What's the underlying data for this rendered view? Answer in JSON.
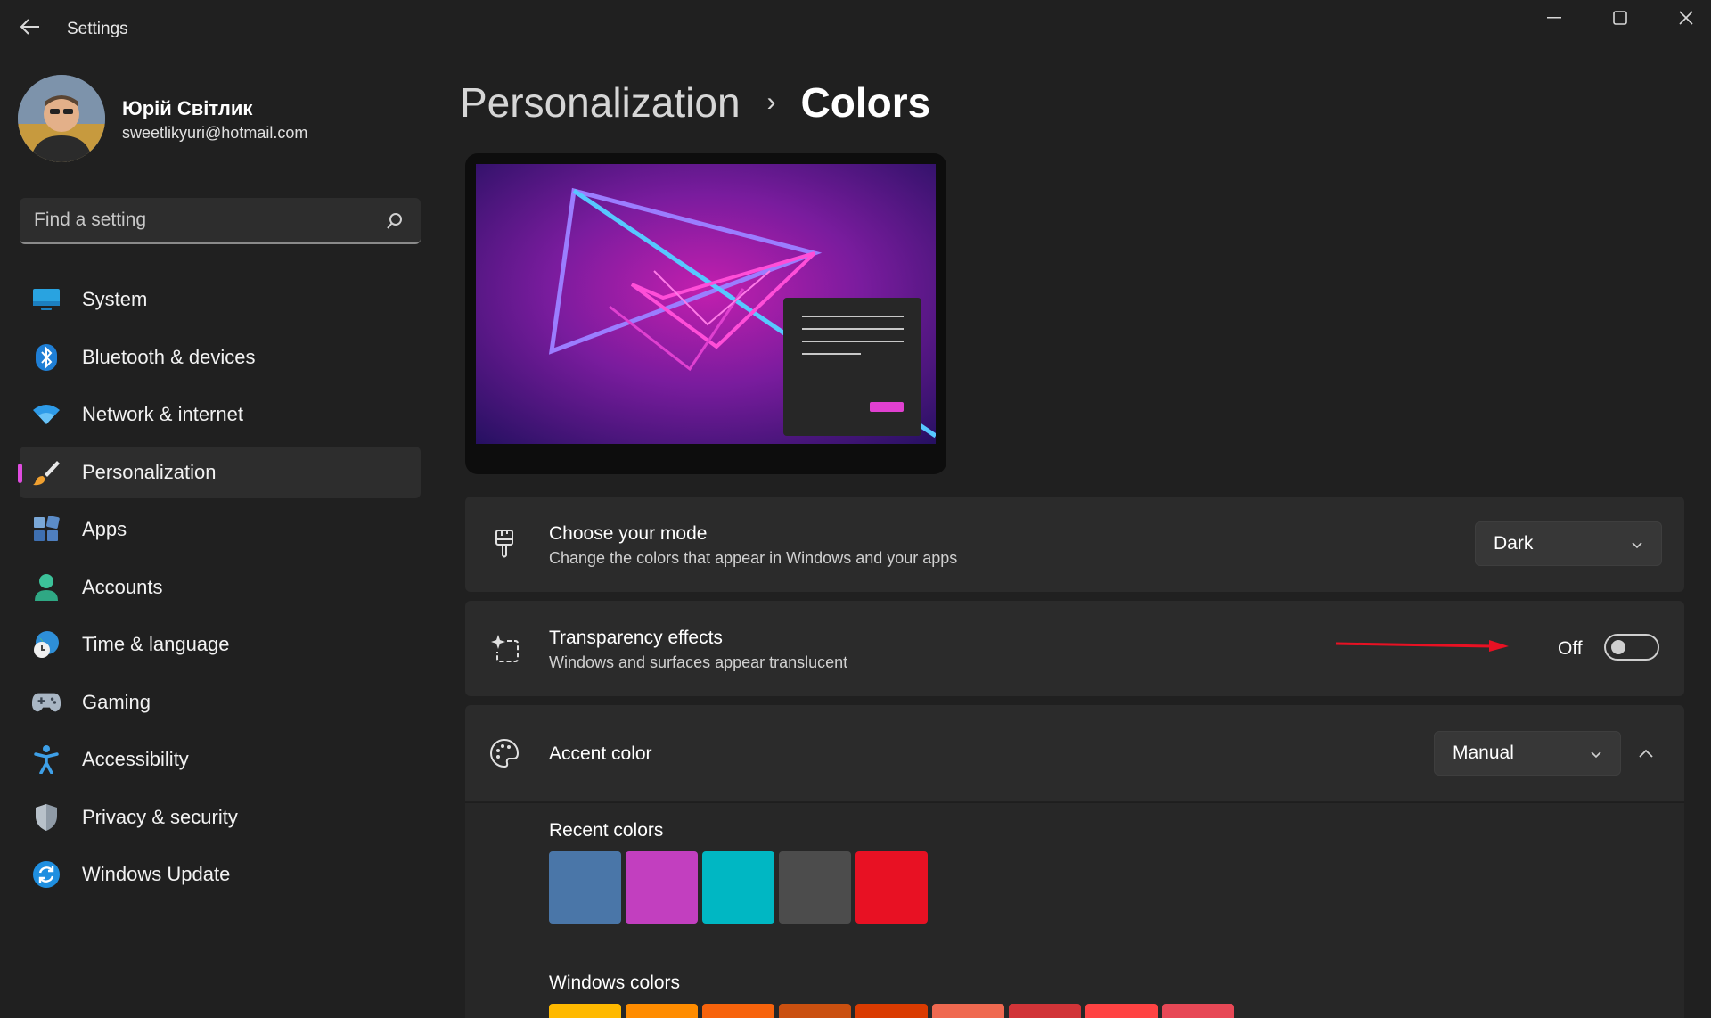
{
  "window": {
    "title": "Settings"
  },
  "profile": {
    "name": "Юрій Світлик",
    "email": "sweetlikyuri@hotmail.com"
  },
  "search": {
    "placeholder": "Find a setting"
  },
  "sidebar": {
    "items": [
      {
        "label": "System",
        "icon": "monitor-icon"
      },
      {
        "label": "Bluetooth & devices",
        "icon": "bluetooth-icon"
      },
      {
        "label": "Network & internet",
        "icon": "wifi-icon"
      },
      {
        "label": "Personalization",
        "icon": "brush-icon",
        "active": true
      },
      {
        "label": "Apps",
        "icon": "apps-icon"
      },
      {
        "label": "Accounts",
        "icon": "person-icon"
      },
      {
        "label": "Time & language",
        "icon": "globe-clock-icon"
      },
      {
        "label": "Gaming",
        "icon": "gamepad-icon"
      },
      {
        "label": "Accessibility",
        "icon": "accessibility-icon"
      },
      {
        "label": "Privacy & security",
        "icon": "shield-icon"
      },
      {
        "label": "Windows Update",
        "icon": "refresh-icon"
      }
    ]
  },
  "header": {
    "parent": "Personalization",
    "separator": "›",
    "current": "Colors"
  },
  "mode": {
    "title": "Choose your mode",
    "description": "Change the colors that appear in Windows and your apps",
    "value": "Dark"
  },
  "transparency": {
    "title": "Transparency effects",
    "description": "Windows and surfaces appear translucent",
    "state_label": "Off",
    "on": false
  },
  "accent": {
    "title": "Accent color",
    "value": "Manual",
    "recent_label": "Recent colors",
    "recent_colors": [
      "#4a76a8",
      "#c23fbf",
      "#00b7c3",
      "#4c4c4c",
      "#e81123"
    ],
    "windows_label": "Windows colors",
    "windows_colors": [
      "#ffb900",
      "#ff8c00",
      "#f7630c",
      "#ca5010",
      "#da3b01",
      "#ef6950",
      "#d13438",
      "#ff4343",
      "#e74856"
    ]
  },
  "annotation": {
    "arrow_color": "#e81123"
  }
}
